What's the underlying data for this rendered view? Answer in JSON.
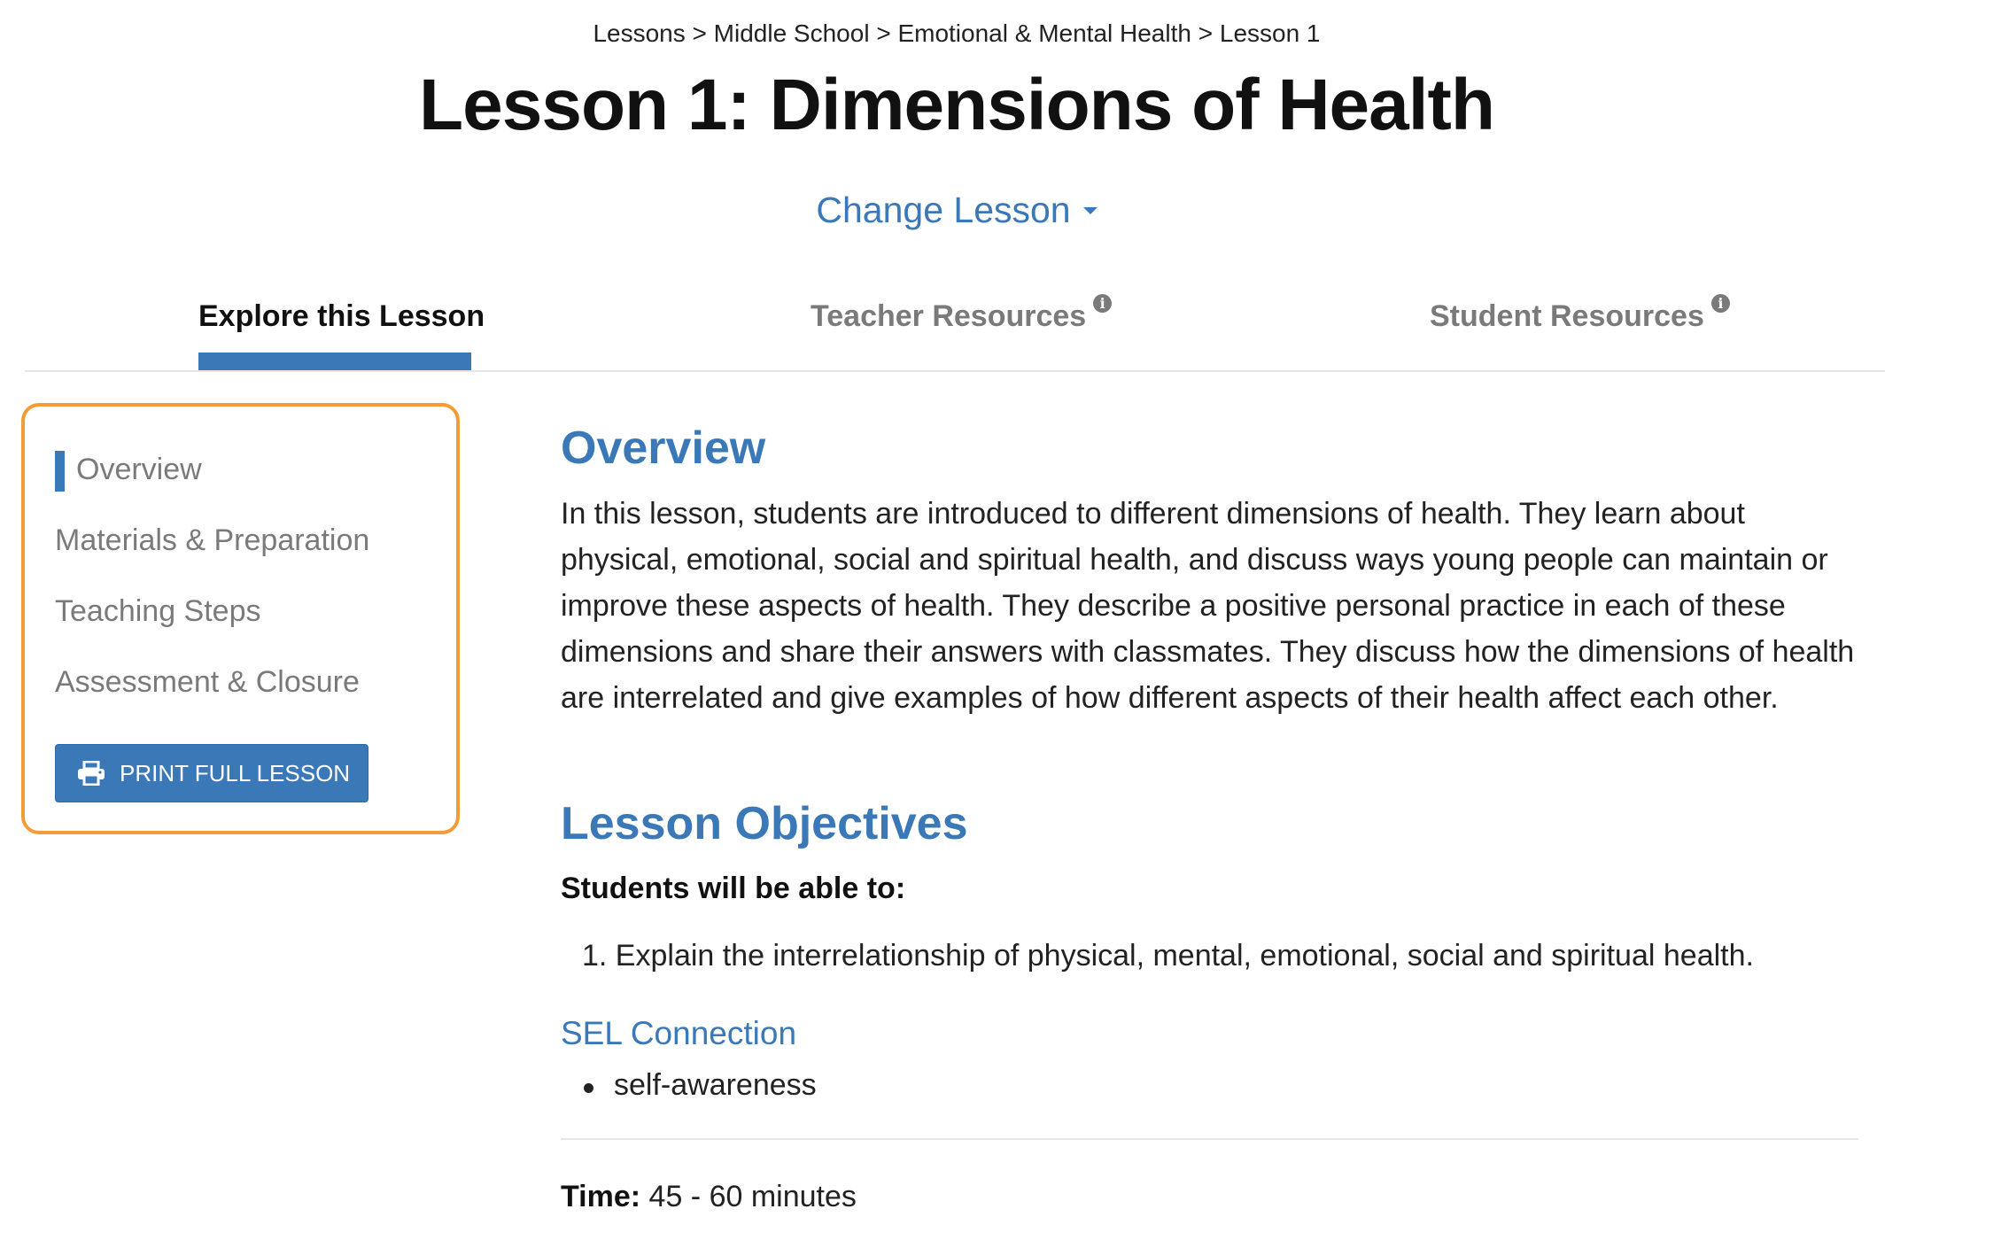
{
  "breadcrumb": "Lessons > Middle School > Emotional & Mental Health > Lesson 1",
  "page_title": "Lesson 1: Dimensions of Health",
  "change_lesson": "Change Lesson",
  "tabs": [
    {
      "label": "Explore this Lesson",
      "active": true
    },
    {
      "label": "Teacher Resources",
      "info_icon": "info-icon"
    },
    {
      "label": "Student Resources",
      "info_icon": "info-icon"
    }
  ],
  "sidenav": {
    "items": [
      {
        "label": "Overview",
        "active": true
      },
      {
        "label": "Materials & Preparation"
      },
      {
        "label": "Teaching Steps"
      },
      {
        "label": "Assessment & Closure"
      }
    ],
    "print_button": "PRINT FULL LESSON",
    "print_icon": "printer-icon"
  },
  "overview": {
    "heading": "Overview",
    "text": "In this lesson, students are introduced to different dimensions of health. They learn about physical, emotional, social and spiritual health, and discuss ways young people can maintain or improve these aspects of health. They describe a positive personal practice in each of these dimensions and share their answers with classmates. They discuss how the dimensions of health are interrelated and give examples of how different aspects of their health affect each other."
  },
  "objectives": {
    "heading": "Lesson Objectives",
    "intro": "Students will be able to:",
    "items": [
      "1. Explain the interrelationship of physical, mental, emotional, social and spiritual health."
    ]
  },
  "sel": {
    "heading": "SEL Connection",
    "items": [
      "self-awareness"
    ]
  },
  "time": {
    "label": "Time:",
    "value": "45 - 60 minutes"
  },
  "colors": {
    "accent_blue": "#3a78b8",
    "sidenav_border": "#f29c38",
    "muted_text": "#7a7a7a"
  }
}
